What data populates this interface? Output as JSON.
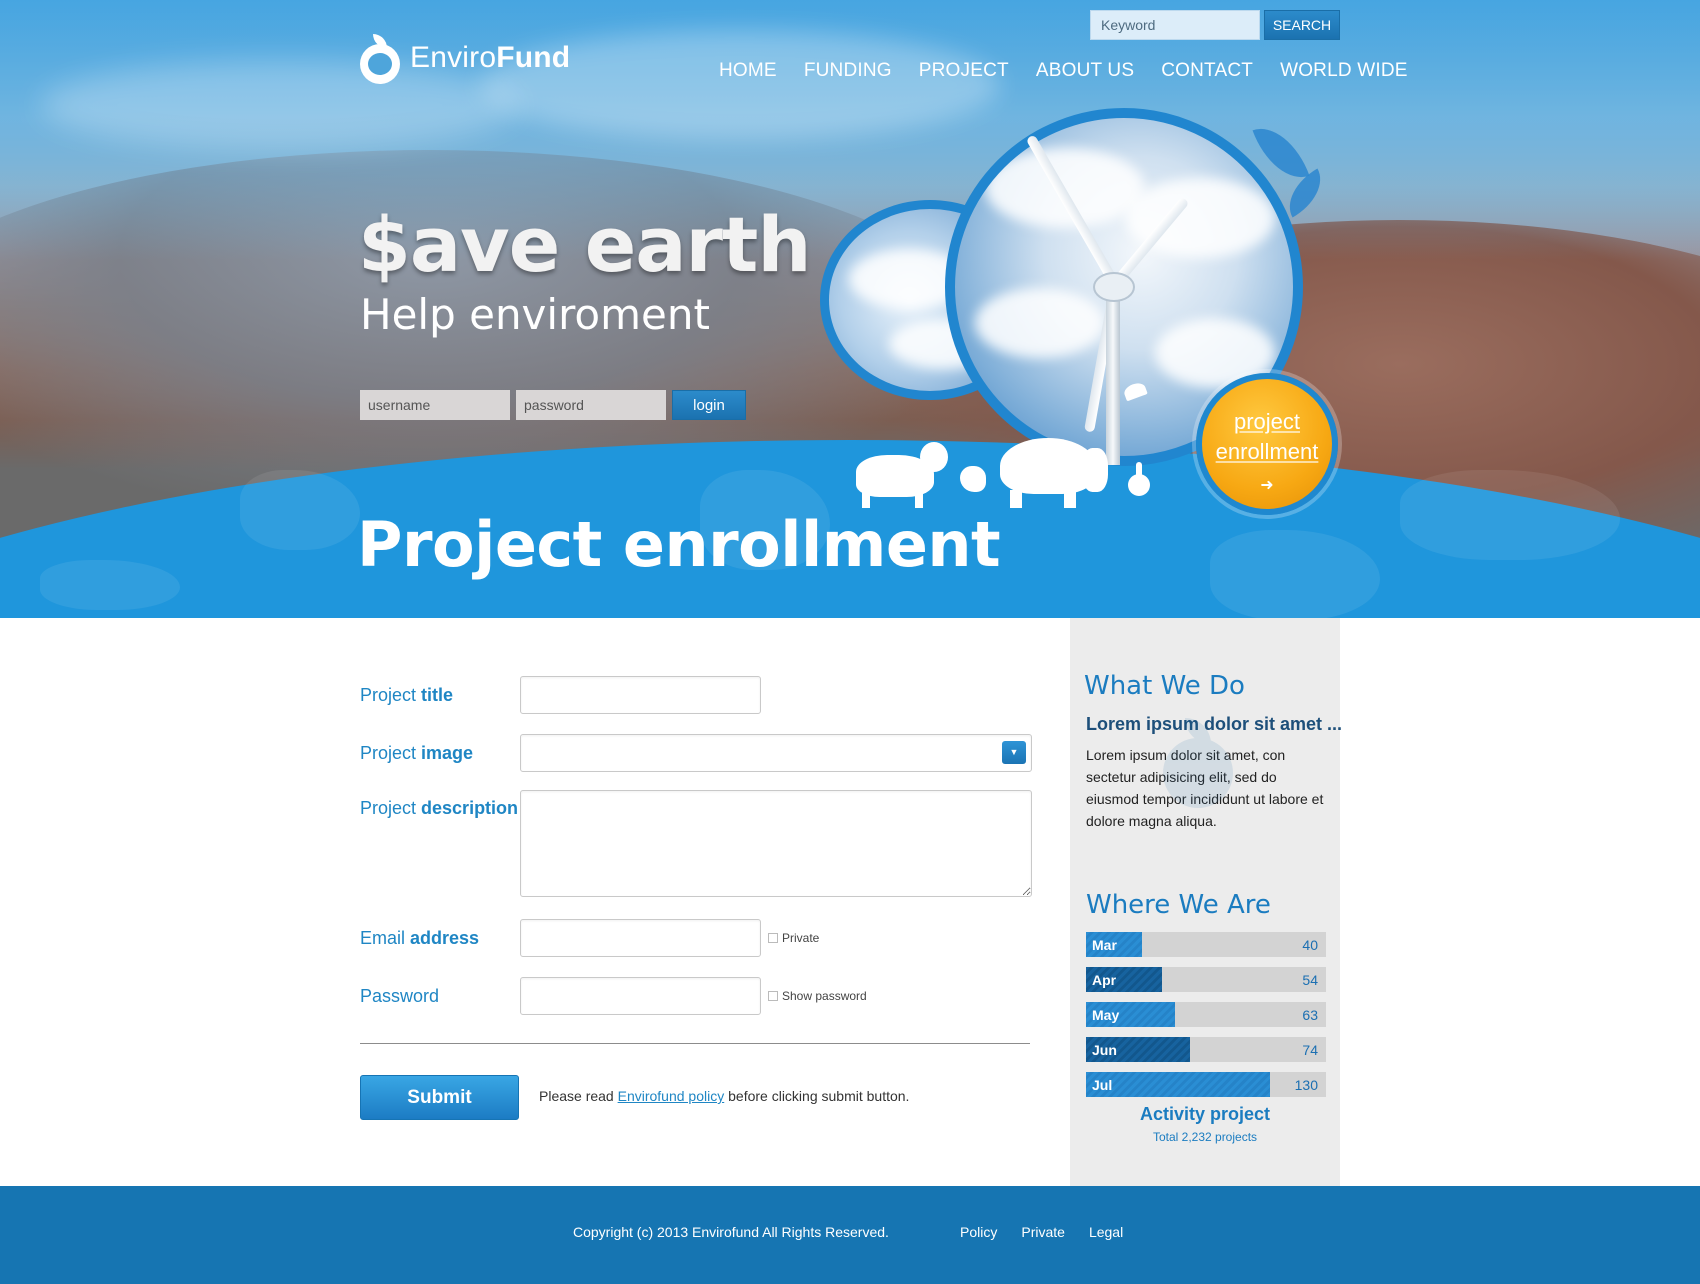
{
  "brand": {
    "name_light": "Enviro",
    "name_bold": "Fund"
  },
  "search": {
    "placeholder": "Keyword",
    "button": "SEARCH"
  },
  "nav": [
    "HOME",
    "FUNDING",
    "PROJECT",
    "ABOUT US",
    "CONTACT",
    "WORLD WIDE"
  ],
  "hero": {
    "headline": "$ave earth",
    "subline": "Help enviroment",
    "login": {
      "username_placeholder": "username",
      "password_placeholder": "password",
      "button": "login"
    },
    "cta": {
      "line1": "project",
      "line2": "enrollment",
      "icon": "arrow-right-icon"
    }
  },
  "page_heading": "Project enrollment",
  "form": {
    "title_label": {
      "plain": "Project ",
      "bold": "title"
    },
    "image_label": {
      "plain": "Project ",
      "bold": "image"
    },
    "description_label": {
      "plain": "Project ",
      "bold": "description"
    },
    "email_label": {
      "plain": "Email ",
      "bold": "address"
    },
    "password_label": "Password",
    "email_checkbox": "Private",
    "password_checkbox": "Show password",
    "select_icon": "chevron-down-icon",
    "submit": "Submit",
    "policy": {
      "before": "Please read ",
      "link": "Envirofund policy",
      "after": " before clicking submit button."
    }
  },
  "sidebar": {
    "what_we_do": {
      "title": "What We Do",
      "subtitle": "Lorem ipsum dolor sit amet ...",
      "text": "Lorem ipsum dolor sit amet, con sectetur adipisicing elit, sed do eiusmod tempor incididunt ut labore et dolore magna aliqua."
    },
    "where_we_are": {
      "title": "Where We Are",
      "bars": [
        {
          "month": "Mar",
          "value": 40
        },
        {
          "month": "Apr",
          "value": 54
        },
        {
          "month": "May",
          "value": 63
        },
        {
          "month": "Jun",
          "value": 74
        },
        {
          "month": "Jul",
          "value": 130
        }
      ],
      "activity_title": "Activity project",
      "activity_total": "Total 2,232 projects"
    }
  },
  "footer": {
    "copyright": "Copyright (c) 2013 Envirofund All Rights Reserved.",
    "links": [
      "Policy",
      "Private",
      "Legal"
    ]
  },
  "colors": {
    "primary": "#1f96dc",
    "accent": "#f7a813",
    "footer": "#1675b2",
    "label": "#1f86c4"
  }
}
